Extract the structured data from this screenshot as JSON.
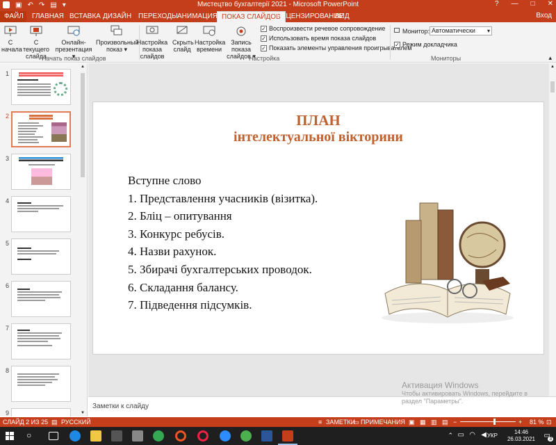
{
  "titlebar": {
    "title": "Мистецтво бухгалтерії 2021 - Microsoft PowerPoint",
    "help": "?",
    "minimize": "—",
    "maximize": "□",
    "close": "✕"
  },
  "tabs": {
    "file": "ФАЙЛ",
    "items": [
      "ГЛАВНАЯ",
      "ВСТАВКА",
      "ДИЗАЙН",
      "ПЕРЕХОДЫ",
      "АНИМАЦИЯ",
      "ПОКАЗ СЛАЙДОВ",
      "РЕЦЕНЗИРОВАНИЕ",
      "ВИД"
    ],
    "active": "ПОКАЗ СЛАЙДОВ",
    "login": "Вход"
  },
  "ribbon": {
    "start": {
      "from_start": [
        "С",
        "начала"
      ],
      "from_current": [
        "С текущего",
        "слайда"
      ],
      "online": [
        "Онлайн-",
        "презентация ▾"
      ],
      "custom": [
        "Произвольный",
        "показ ▾"
      ],
      "label": "Начать показ слайдов"
    },
    "setup": {
      "setup_show": [
        "Настройка",
        "показа слайдов"
      ],
      "hide_slide": [
        "Скрыть",
        "слайд"
      ],
      "rehearse": [
        "Настройка",
        "времени"
      ],
      "record": [
        "Запись показа",
        "слайдов ▾"
      ],
      "checks": [
        "Воспроизвести речевое сопровождение",
        "Использовать время показа слайдов",
        "Показать элементы управления проигрывателем"
      ],
      "label": "Настройка"
    },
    "monitors": {
      "monitor_label": "Монитор:",
      "monitor_value": "Автоматически",
      "presenter_view": "Режим докладчика",
      "label": "Мониторы"
    }
  },
  "slides": {
    "numbers": [
      "1",
      "2",
      "3",
      "4",
      "5",
      "6",
      "7",
      "8",
      "9"
    ],
    "selected": "2"
  },
  "slide": {
    "title_line1": "ПЛАН",
    "title_line2": "інтелектуальної вікторини",
    "body": [
      "Вступне слово",
      "1.   Представлення учасників (візитка).",
      "2. Бліц – опитування",
      "3. Конкурс ребусів.",
      "4. Назви рахунок.",
      "5. Збирачі бухгалтерських проводок.",
      "6. Складання балансу.",
      "7. Підведення підсумків."
    ]
  },
  "notes_placeholder": "Заметки к слайду",
  "watermark": {
    "line1": "Активация Windows",
    "line2": "Чтобы активировать Windows, перейдите в",
    "line3": "раздел \"Параметры\"."
  },
  "status": {
    "slide_info": "СЛАЙД 2 ИЗ 25",
    "language": "РУССКИЙ",
    "notes": "ЗАМЕТКИ",
    "comments": "ПРИМЕЧАНИЯ",
    "zoom": "81 %"
  },
  "taskbar": {
    "lang": "УКР",
    "time": "14:46",
    "date": "26.03.2021",
    "badge": "3"
  },
  "colors": {
    "accent": "#c43e1c",
    "title": "#c0622f"
  }
}
